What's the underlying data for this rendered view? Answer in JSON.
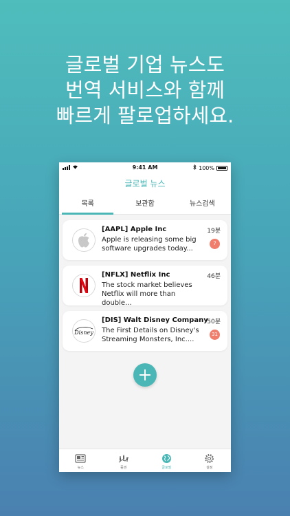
{
  "headline": {
    "line1": "글로벌 기업 뉴스도",
    "line2": "번역 서비스와 함께",
    "line3": "빠르게 팔로업하세요."
  },
  "status_bar": {
    "time": "9:41 AM",
    "battery": "100%"
  },
  "app": {
    "title": "글로벌 뉴스"
  },
  "tabs": [
    {
      "label": "목록",
      "active": true
    },
    {
      "label": "보관함",
      "active": false
    },
    {
      "label": "뉴스검색",
      "active": false
    }
  ],
  "news": [
    {
      "logo": "apple-logo",
      "title": "[AAPL] Apple Inc",
      "summary": "Apple is releasing some big software upgrades today...",
      "time": "19분",
      "count": "7"
    },
    {
      "logo": "netflix-logo",
      "title": "[NFLX] Netflix Inc",
      "summary": "The stock market believes Netflix will more than double...",
      "time": "46분",
      "count": ""
    },
    {
      "logo": "disney-logo",
      "title": "[DIS] Walt Disney Company",
      "summary": "The First Details on Disney's Streaming Monsters, Inc....",
      "time": "50분",
      "count": "31",
      "logo_text": "Disney"
    }
  ],
  "bottom_nav": [
    {
      "label": "뉴스",
      "icon": "newspaper-icon",
      "active": false
    },
    {
      "label": "증권",
      "icon": "chart-icon",
      "active": false
    },
    {
      "label": "글로벌",
      "icon": "globe-icon",
      "active": true
    },
    {
      "label": "설정",
      "icon": "gear-icon",
      "active": false
    }
  ],
  "colors": {
    "accent": "#4ab7b6",
    "badge": "#ef7e6d",
    "netflix": "#d81f26"
  }
}
